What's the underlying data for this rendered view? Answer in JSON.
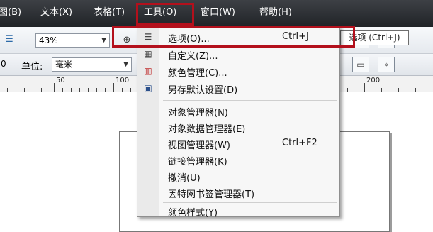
{
  "menubar": {
    "items": [
      "图(B)",
      "文本(X)",
      "表格(T)",
      "工具(O)",
      "窗口(W)",
      "帮助(H)"
    ]
  },
  "toolbar": {
    "zoom_value": "43%",
    "units_label": "单位:",
    "units_value": "毫米",
    "partial_left_label": "0"
  },
  "ruler": {
    "labels": [
      "50",
      "100",
      "200"
    ]
  },
  "tools_menu": {
    "items": [
      {
        "icon": "options-icon",
        "label": "选项(O)...",
        "shortcut": "Ctrl+J"
      },
      {
        "icon": "customize-icon",
        "label": "自定义(Z)...",
        "shortcut": ""
      },
      {
        "icon": "color-management-icon",
        "label": "颜色管理(C)...",
        "shortcut": ""
      },
      {
        "icon": "save-defaults-icon",
        "label": "另存默认设置(D)",
        "shortcut": ""
      },
      {
        "icon": "",
        "label": "对象管理器(N)",
        "shortcut": ""
      },
      {
        "icon": "",
        "label": "对象数据管理器(E)",
        "shortcut": ""
      },
      {
        "icon": "",
        "label": "视图管理器(W)",
        "shortcut": "Ctrl+F2"
      },
      {
        "icon": "",
        "label": "链接管理器(K)",
        "shortcut": ""
      },
      {
        "icon": "",
        "label": "撤消(U)",
        "shortcut": ""
      },
      {
        "icon": "",
        "label": "因特网书签管理器(T)",
        "shortcut": ""
      },
      {
        "icon": "",
        "label": "颜色样式(Y)",
        "shortcut": ""
      }
    ]
  },
  "tooltip": {
    "text": "选项 (Ctrl+J)"
  },
  "colors": {
    "highlight": "#b3101c",
    "menubar": "#2b2e33"
  }
}
